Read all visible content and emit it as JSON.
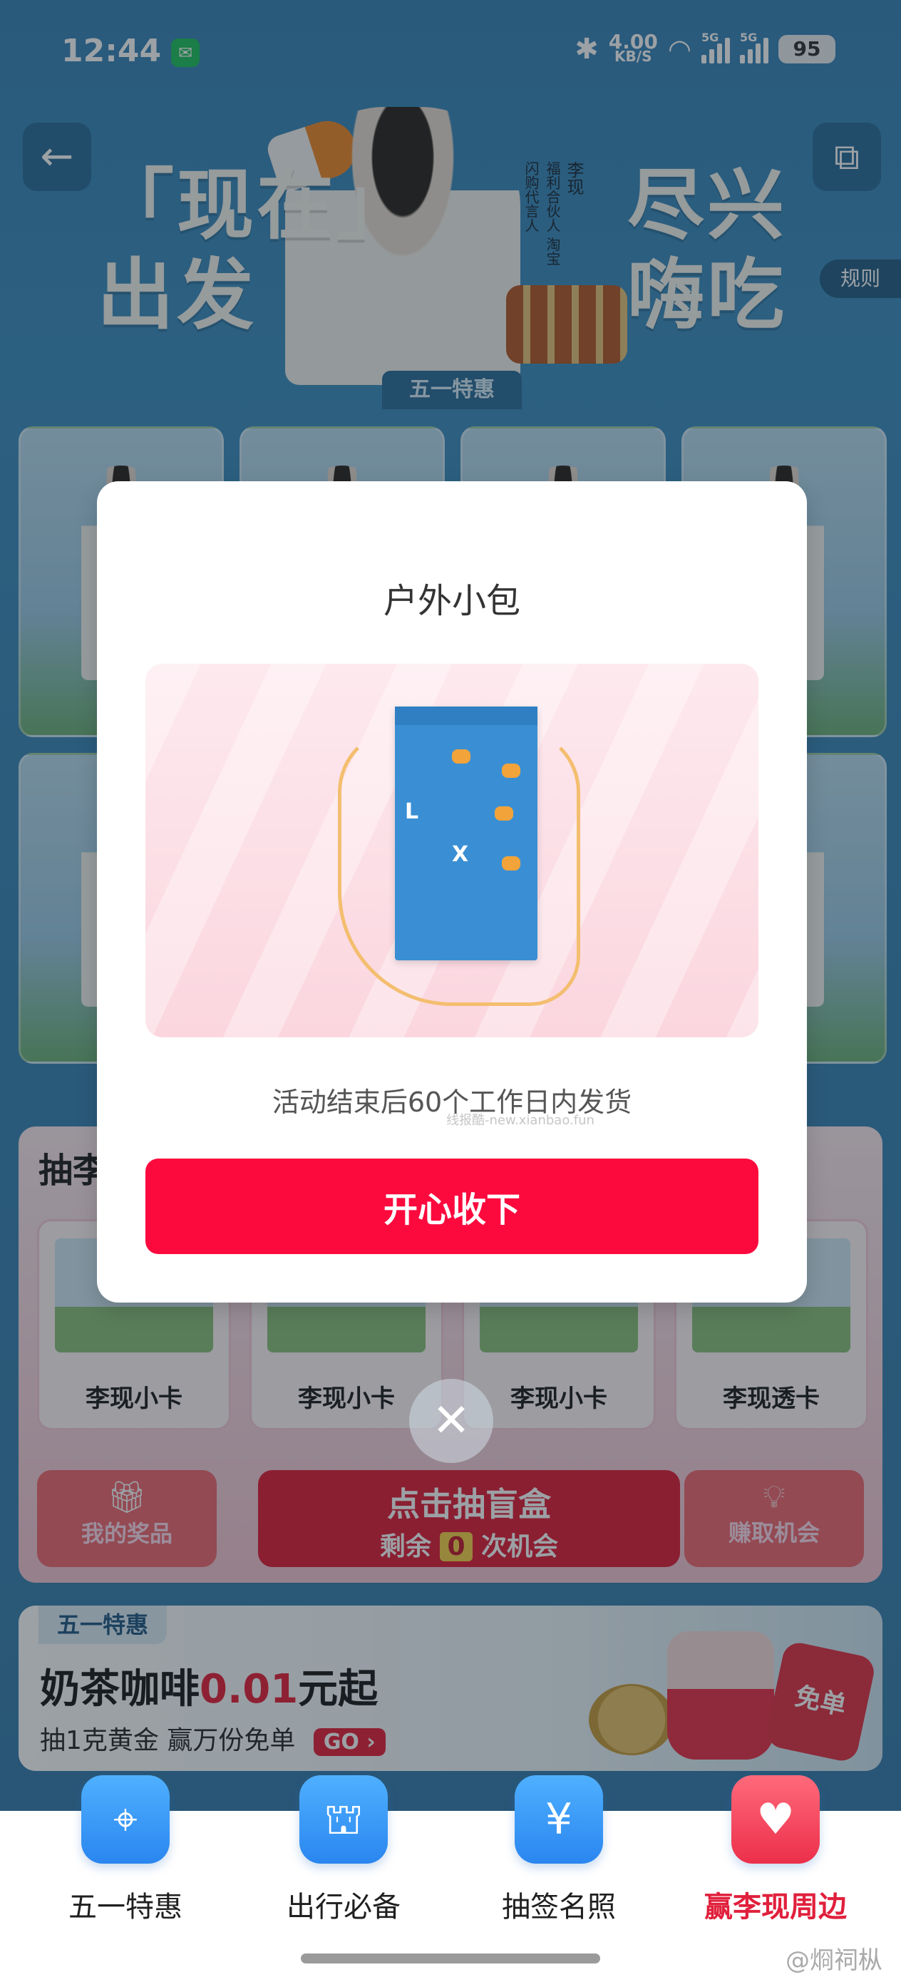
{
  "status_bar": {
    "time": "12:44",
    "app_badge": "wechat-icon",
    "net_speed_value": "4.00",
    "net_speed_unit": "KB/S",
    "signal_1": "5G",
    "signal_2": "5G",
    "battery": "95"
  },
  "header": {
    "back_icon": "arrow-left-icon",
    "share_icon": "external-link-icon",
    "rules_label": "规则",
    "slogan_left": "「现在」\n出发",
    "slogan_right": "尽兴\n嗨吃",
    "celebrity_name": "李现",
    "celebrity_role": "福利合伙人 淘宝闪购代言人",
    "badge": "五一特惠"
  },
  "lottery": {
    "title": "抽李",
    "prizes": [
      {
        "name": "李现小卡"
      },
      {
        "name": "李现小卡"
      },
      {
        "name": "李现小卡"
      },
      {
        "name": "李现透卡"
      }
    ],
    "my_prizes_label": "我的奖品",
    "draw_label": "点击抽盲盒",
    "remaining_prefix": "剩余",
    "remaining_count": "0",
    "remaining_suffix": "次机会",
    "earn_label": "赚取机会"
  },
  "promo": {
    "tag": "五一特惠",
    "title_prefix": "奶茶咖啡",
    "title_price": "0.01",
    "title_suffix": "元起",
    "subtitle": "抽1克黄金 赢万份免单",
    "go_label": "GO",
    "redbag_label": "免单"
  },
  "modal": {
    "title": "户外小包",
    "pouch_letters": [
      "L",
      "X"
    ],
    "delivery_note": "活动结束后60个工作日内发货",
    "watermark": "线报酷-new.xianbao.fun",
    "confirm_label": "开心收下"
  },
  "tabs": [
    {
      "label": "五一特惠",
      "icon": "map-pin-icon",
      "active": false
    },
    {
      "label": "出行必备",
      "icon": "basket-icon",
      "active": false
    },
    {
      "label": "抽签名照",
      "icon": "ticket-yen-icon",
      "active": false
    },
    {
      "label": "赢李现周边",
      "icon": "gift-heart-icon",
      "active": true
    }
  ],
  "footer_mark": "@烱祠枞",
  "colors": {
    "primary_red": "#fc0a3e",
    "tab_blue": "#2a86ef",
    "active_tab": "#e0203c"
  }
}
